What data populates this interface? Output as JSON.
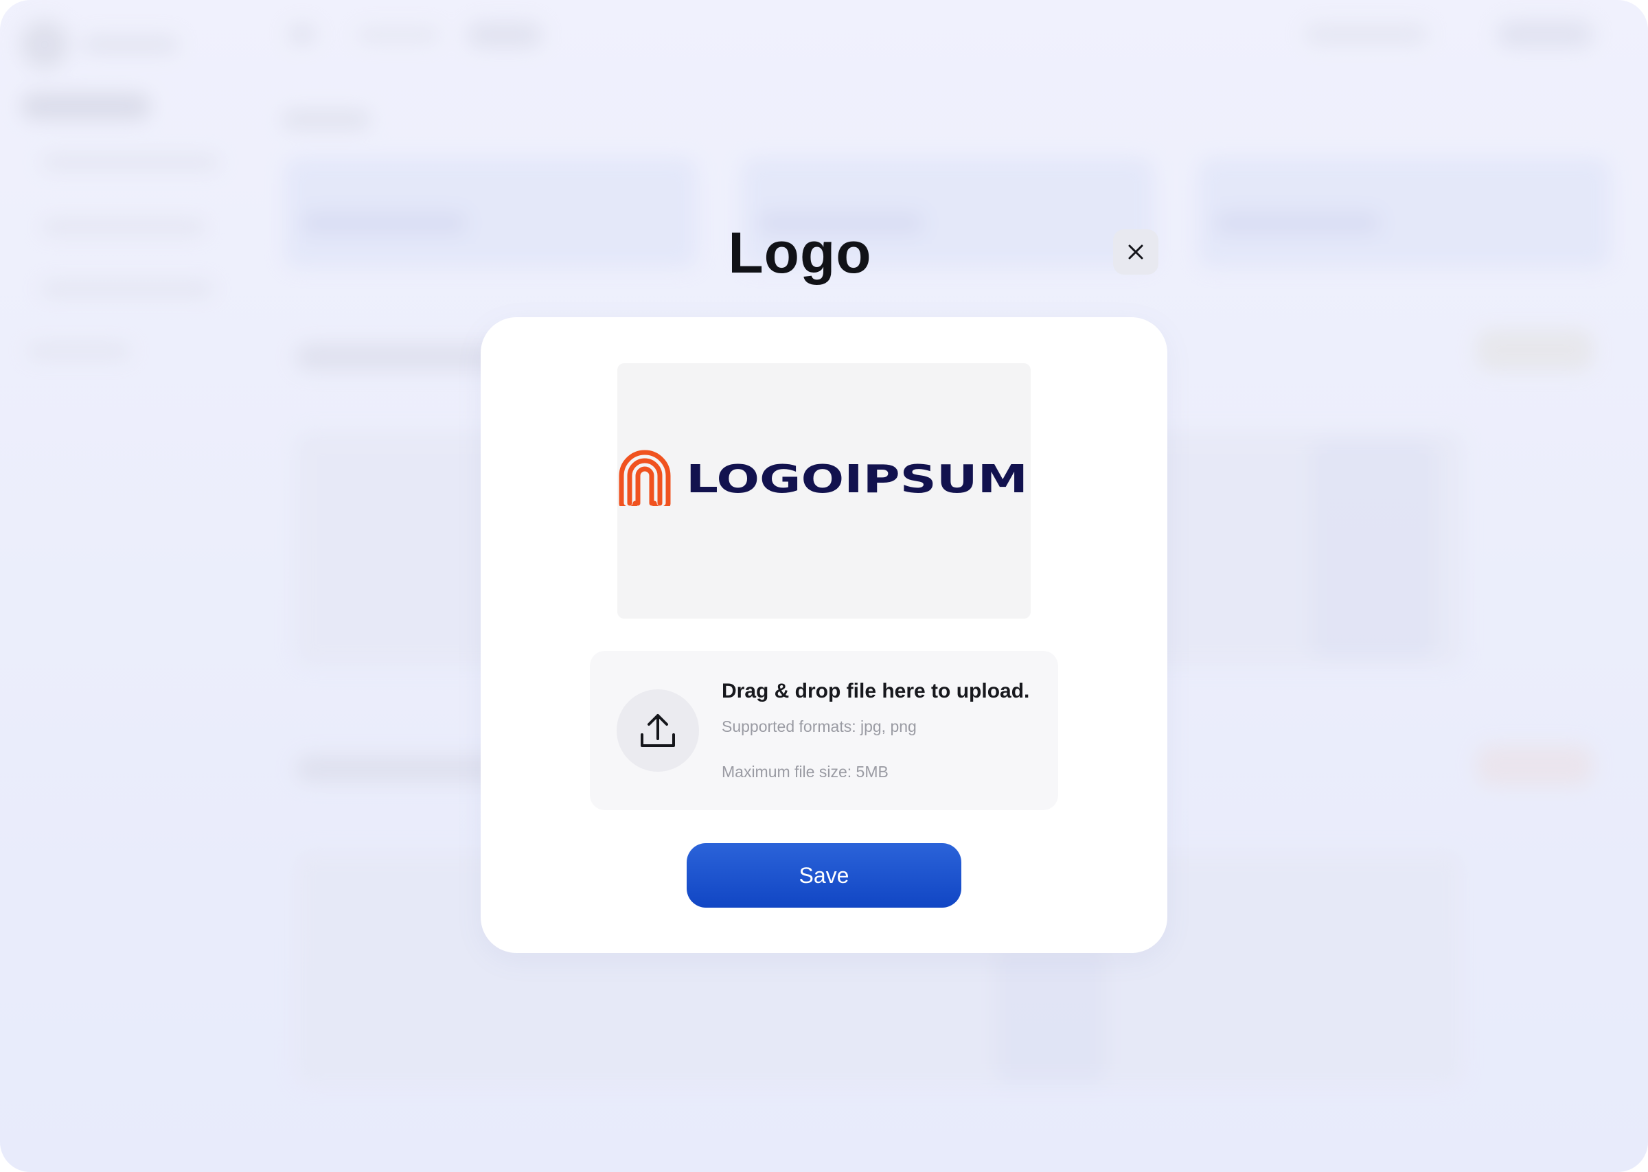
{
  "modal": {
    "title": "Logo",
    "close_icon": "close-icon",
    "preview": {
      "logo_icon": "fingerprint-logo-icon",
      "logo_text": "LOGOIPSUM",
      "brand_colors": {
        "mark": "#f0521f",
        "wordmark": "#12124e"
      }
    },
    "upload": {
      "icon": "upload-icon",
      "title": "Drag & drop file here to upload.",
      "formats": "Supported formats: jpg, png",
      "max_size": "Maximum file size: 5MB"
    },
    "save_label": "Save"
  },
  "colors": {
    "accent": "#1a4fcf",
    "title": "#111217",
    "muted_text": "#9a9ba3"
  }
}
